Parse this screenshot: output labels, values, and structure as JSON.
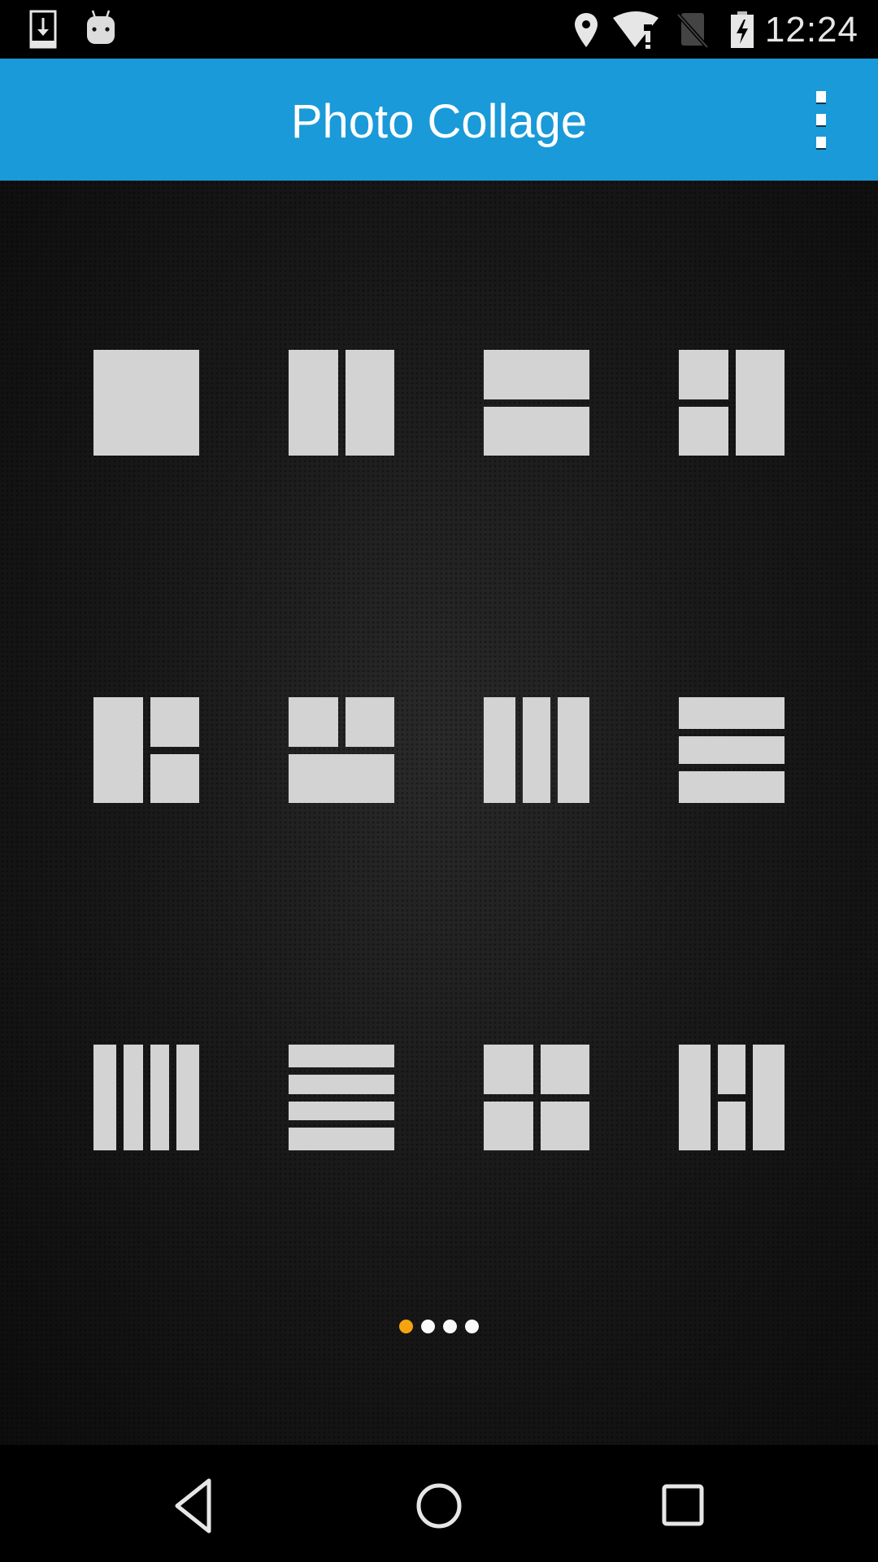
{
  "status_bar": {
    "time": "12:24",
    "left_icons": [
      "download-notification-icon",
      "android-notification-icon"
    ],
    "right_icons": [
      "location-icon",
      "wifi-no-internet-icon",
      "no-sim-icon",
      "battery-charging-icon"
    ]
  },
  "app_bar": {
    "title": "Photo Collage",
    "overflow_menu_icon": "more-vert-icon",
    "background_color": "#1a9ad9"
  },
  "layouts": [
    {
      "id": "layout-1-single",
      "cells": [
        [
          0,
          0,
          1,
          1
        ]
      ]
    },
    {
      "id": "layout-2-columns",
      "cells": [
        [
          0,
          0,
          0.5,
          1
        ],
        [
          0.5,
          0,
          1,
          1
        ]
      ]
    },
    {
      "id": "layout-2-rows",
      "cells": [
        [
          0,
          0,
          1,
          0.5
        ],
        [
          0,
          0.5,
          1,
          1
        ]
      ]
    },
    {
      "id": "layout-3-left-split",
      "cells": [
        [
          0,
          0,
          0.5,
          0.5
        ],
        [
          0,
          0.5,
          0.5,
          1
        ],
        [
          0.5,
          0,
          1,
          1
        ]
      ]
    },
    {
      "id": "layout-3-right-split",
      "cells": [
        [
          0,
          0,
          0.5,
          1
        ],
        [
          0.5,
          0,
          1,
          0.5
        ],
        [
          0.5,
          0.5,
          1,
          1
        ]
      ]
    },
    {
      "id": "layout-3-top-split",
      "cells": [
        [
          0,
          0,
          0.5,
          0.5
        ],
        [
          0.5,
          0,
          1,
          0.5
        ],
        [
          0,
          0.5,
          1,
          1
        ]
      ]
    },
    {
      "id": "layout-3-columns",
      "cells": [
        [
          0,
          0,
          0.333,
          1
        ],
        [
          0.333,
          0,
          0.667,
          1
        ],
        [
          0.667,
          0,
          1,
          1
        ]
      ]
    },
    {
      "id": "layout-3-rows",
      "cells": [
        [
          0,
          0,
          1,
          0.333
        ],
        [
          0,
          0.333,
          1,
          0.667
        ],
        [
          0,
          0.667,
          1,
          1
        ]
      ]
    },
    {
      "id": "layout-4-columns",
      "cells": [
        [
          0,
          0,
          0.25,
          1
        ],
        [
          0.25,
          0,
          0.5,
          1
        ],
        [
          0.5,
          0,
          0.75,
          1
        ],
        [
          0.75,
          0,
          1,
          1
        ]
      ]
    },
    {
      "id": "layout-4-rows",
      "cells": [
        [
          0,
          0,
          1,
          0.25
        ],
        [
          0,
          0.25,
          1,
          0.5
        ],
        [
          0,
          0.5,
          1,
          0.75
        ],
        [
          0,
          0.75,
          1,
          1
        ]
      ]
    },
    {
      "id": "layout-4-grid",
      "cells": [
        [
          0,
          0,
          0.5,
          0.5
        ],
        [
          0.5,
          0,
          1,
          0.5
        ],
        [
          0,
          0.5,
          0.5,
          1
        ],
        [
          0.5,
          0.5,
          1,
          1
        ]
      ]
    },
    {
      "id": "layout-4-middle-split",
      "cells": [
        [
          0,
          0,
          0.333,
          1
        ],
        [
          0.333,
          0,
          0.667,
          0.5
        ],
        [
          0.333,
          0.5,
          0.667,
          1
        ],
        [
          0.667,
          0,
          1,
          1
        ]
      ]
    }
  ],
  "pager": {
    "page_count": 4,
    "current_page": 1,
    "active_color": "#f5a30f",
    "inactive_color": "#fafafa"
  },
  "nav_bar": {
    "buttons": [
      "back-icon",
      "home-icon",
      "recents-icon"
    ]
  }
}
